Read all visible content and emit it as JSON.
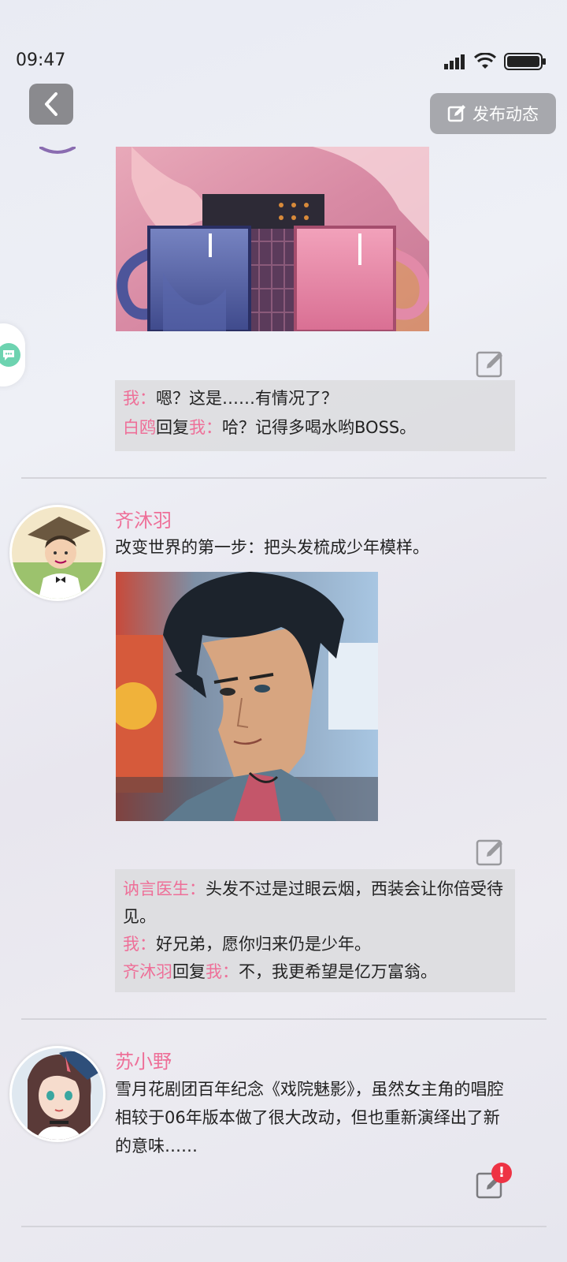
{
  "status": {
    "time": "09:47"
  },
  "header": {
    "publish_label": "发布动态"
  },
  "posts": [
    {
      "comments": [
        {
          "author": "我",
          "sep": "：",
          "text": "嗯？这是……有情况了？"
        },
        {
          "author": "白鸥",
          "reply_word": "回复",
          "target": "我",
          "sep": "：",
          "text": "哈？记得多喝水哟BOSS。"
        }
      ]
    },
    {
      "name": "齐沐羽",
      "text": "改变世界的第一步：把头发梳成少年模样。",
      "comments": [
        {
          "author": "讷言医生",
          "sep": "：",
          "text": "头发不过是过眼云烟，西装会让你倍受待见。"
        },
        {
          "author": "我",
          "sep": "：",
          "text": "好兄弟，愿你归来仍是少年。"
        },
        {
          "author": "齐沐羽",
          "reply_word": "回复",
          "target": "我",
          "sep": "：",
          "text": "不，我更希望是亿万富翁。"
        }
      ]
    },
    {
      "name": "苏小野",
      "text": "雪月花剧团百年纪念《戏院魅影》，虽然女主角的唱腔相较于06年版本做了很大改动，但也重新演绎出了新的意味……",
      "badge": "!"
    }
  ],
  "colors": {
    "accent_pink": "#ee6f98",
    "comment_bg": "#dcdcde",
    "badge_red": "#ee3344"
  },
  "icons": [
    "back-icon",
    "edit-icon",
    "wifi-icon",
    "signal-icon",
    "battery-icon",
    "chat-icon"
  ]
}
